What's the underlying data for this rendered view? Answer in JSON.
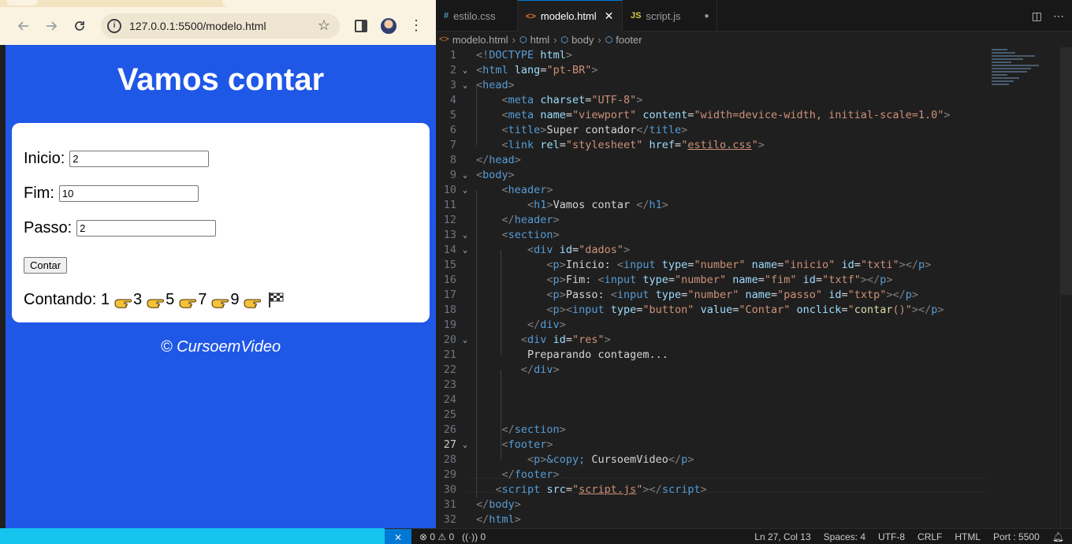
{
  "browser": {
    "url": "127.0.0.1:5500/modelo.html",
    "page": {
      "title": "Vamos contar",
      "fields": [
        {
          "label": "Inicio:",
          "value": "2"
        },
        {
          "label": "Fim:",
          "value": "10"
        },
        {
          "label": "Passo:",
          "value": "2"
        }
      ],
      "button_label": "Contar",
      "result_label": "Contando: 1",
      "counts": [
        "3",
        "5",
        "7",
        "9"
      ],
      "footer": "© CursoemVideo"
    }
  },
  "vscode": {
    "tabs": [
      {
        "name": "estilo.css",
        "icon": "#"
      },
      {
        "name": "modelo.html",
        "icon": "<>"
      },
      {
        "name": "script.js",
        "icon": "JS"
      }
    ],
    "breadcrumb": [
      "modelo.html",
      "html",
      "body",
      "footer"
    ],
    "status": {
      "problems": "⊗ 0 ⚠ 0",
      "ports_forwarded": "0",
      "position": "Ln 27, Col 13",
      "spaces": "Spaces: 4",
      "encoding": "UTF-8",
      "eol": "CRLF",
      "language": "HTML",
      "port": "Port : 5500"
    }
  }
}
